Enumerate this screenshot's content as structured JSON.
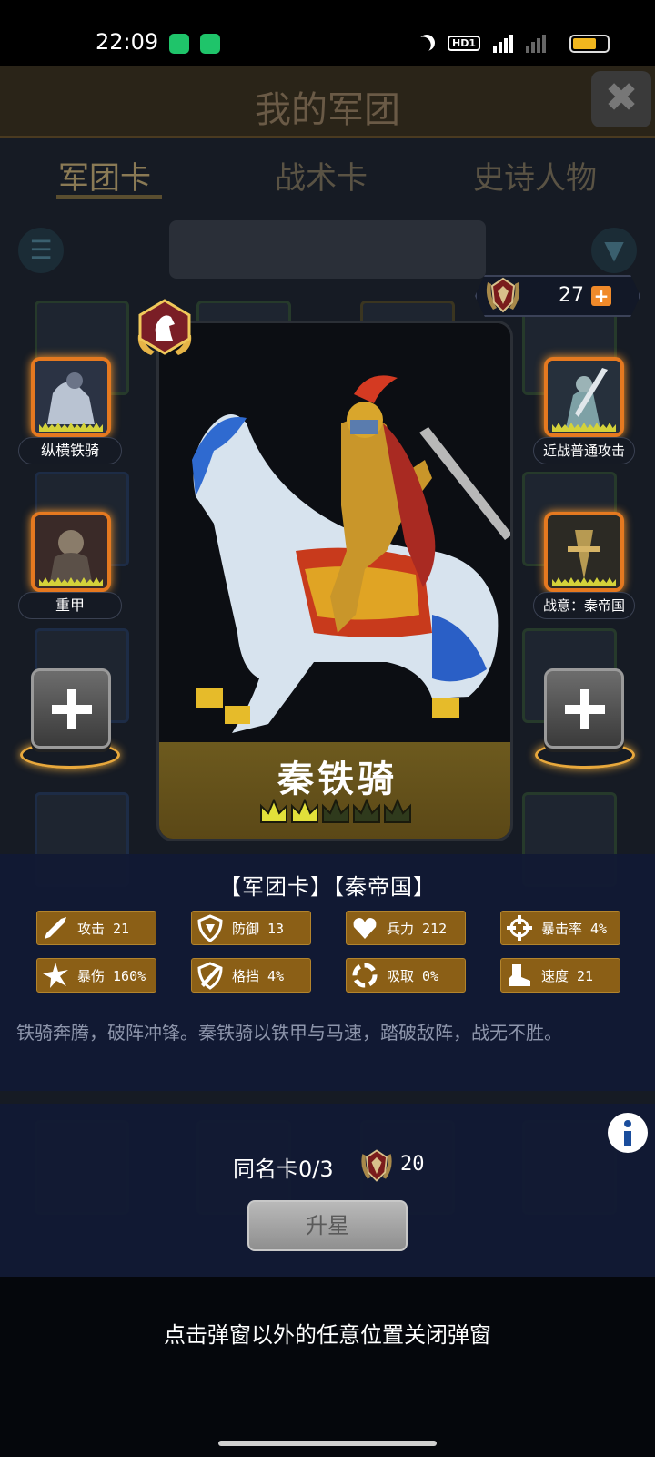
{
  "status_bar": {
    "time": "22:09",
    "icons": [
      "app-notification-icon",
      "upload-icon",
      "moon-icon",
      "hd-icon",
      "5g-signal-icon",
      "signal-icon",
      "battery-icon"
    ],
    "hd_label": "HD1",
    "network_label": "5G"
  },
  "background": {
    "title": "我的军团",
    "tabs": [
      "军团卡",
      "战术卡",
      "史诗人物"
    ]
  },
  "stars": {
    "count": "27",
    "add_symbol": "+"
  },
  "card": {
    "name": "秦铁骑",
    "stars_filled": 2,
    "stars_total": 5,
    "type_badge": "knight-chess-icon"
  },
  "slots": {
    "left_top": "纵横铁骑",
    "left_mid": "重甲",
    "right_top": "近战普通攻击",
    "right_mid": "战意：秦帝国"
  },
  "info": {
    "tags": "【军团卡】【秦帝国】",
    "stats": [
      {
        "label": "攻击 21",
        "icon": "sword-icon"
      },
      {
        "label": "防御 13",
        "icon": "shield-icon"
      },
      {
        "label": "兵力 212",
        "icon": "heart-icon"
      },
      {
        "label": "暴击率 4%",
        "icon": "crosshair-icon"
      },
      {
        "label": "暴伤 160%",
        "icon": "burst-icon"
      },
      {
        "label": "格挡 4%",
        "icon": "block-icon"
      },
      {
        "label": "吸取 0%",
        "icon": "absorb-icon"
      },
      {
        "label": "速度 21",
        "icon": "boot-icon"
      }
    ],
    "description": "铁骑奔腾，破阵冲锋。秦铁骑以铁甲与马速，踏破敌阵，战无不胜。"
  },
  "upgrade": {
    "duplicate_text": "同名卡0/3",
    "cost": "20",
    "button_label": "升星"
  },
  "close_hint": "点击弹窗以外的任意位置关闭弹窗",
  "colors": {
    "panel_bg": "#121a34",
    "stat_bg": "#8b5f16",
    "slot_border": "#e57920",
    "accent_orange": "#f08a2a"
  }
}
